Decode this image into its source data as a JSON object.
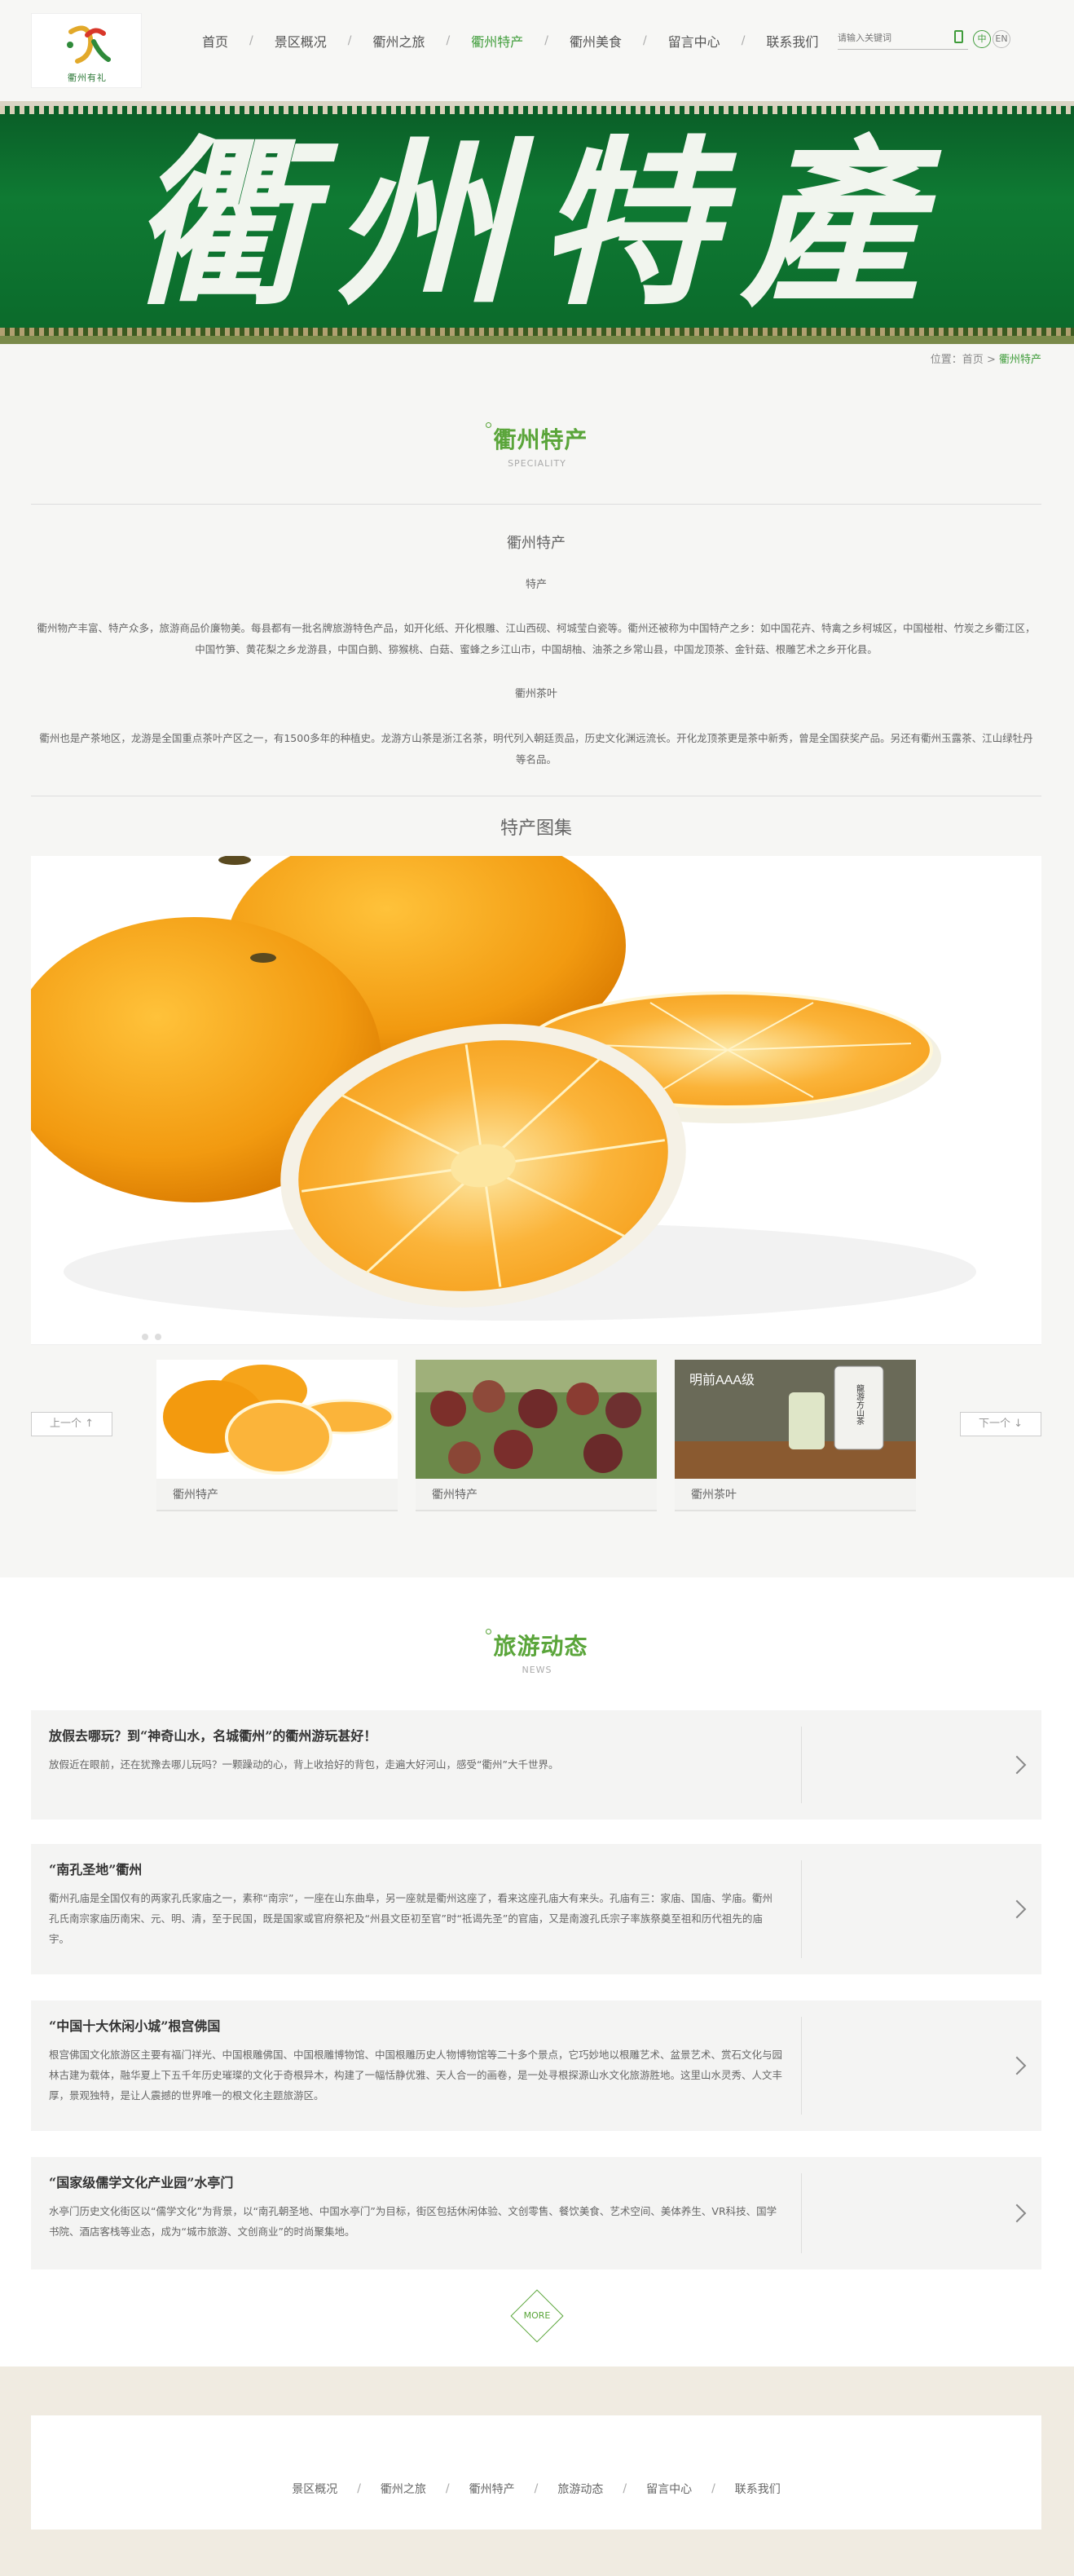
{
  "header": {
    "logo_text": "衢州有礼",
    "nav": [
      "首页",
      "景区概况",
      "衢州之旅",
      "衢州特产",
      "衢州美食",
      "留言中心",
      "联系我们"
    ],
    "active_index": 3,
    "search_placeholder": "请输入关键词",
    "lang_cn": "中",
    "lang_en": "EN"
  },
  "banner": {
    "title": "衢州特產"
  },
  "breadcrumb": {
    "prefix": "位置：",
    "home": "首页",
    "sep": ">",
    "current": "衢州特产"
  },
  "section1": {
    "title": "衢州特产",
    "subtitle": "SPECIALITY",
    "article_title": "衢州特产",
    "sub1": "特产",
    "para1": "衢州物产丰富、特产众多，旅游商品价廉物美。每县都有一批名牌旅游特色产品，如开化纸、开化根雕、江山西砚、柯城莹白瓷等。衢州还被称为中国特产之乡：如中国花卉、特禽之乡柯城区，中国椪柑、竹炭之乡衢江区，中国竹笋、黄花梨之乡龙游县，中国白鹅、猕猴桃、白菇、蜜蜂之乡江山市，中国胡柚、油茶之乡常山县，中国龙顶茶、金针菇、根雕艺术之乡开化县。",
    "sub2": "衢州茶叶",
    "para2": "衢州也是产茶地区，龙游是全国重点茶叶产区之一，有1500多年的种植史。龙游方山茶是浙江名茶，明代列入朝廷贡品，历史文化渊远流长。开化龙顶茶更是茶中新秀，曾是全国获奖产品。另还有衢州玉露茶、江山绿牡丹等名品。"
  },
  "gallery": {
    "title": "特产图集",
    "prev": "上一个 ↑",
    "next": "下一个 ↓",
    "thumbs": [
      {
        "caption": "衢州特产"
      },
      {
        "caption": "衢州特产"
      },
      {
        "caption": "衢州茶叶",
        "pack_text": "明前AAA级",
        "tea_name": "龍游方山茶"
      }
    ]
  },
  "news": {
    "title": "旅游动态",
    "subtitle": "NEWS",
    "items": [
      {
        "title": "放假去哪玩？到“神奇山水，名城衢州”的衢州游玩甚好！",
        "desc": "放假近在眼前，还在犹豫去哪儿玩吗？一颗躁动的心，背上收拾好的背包，走遍大好河山，感受“衢州”大千世界。"
      },
      {
        "title": "“南孔圣地”衢州",
        "desc": "衢州孔庙是全国仅有的两家孔氏家庙之一，素称“南宗”，一座在山东曲阜，另一座就是衢州这座了，看来这座孔庙大有来头。孔庙有三：家庙、国庙、学庙。衢州孔氏南宗家庙历南宋、元、明、清，至于民国，既是国家或官府祭祀及“州县文臣初至官”时“祗谒先圣”的官庙，又是南渡孔氏宗子率族祭奠至祖和历代祖先的庙宇。"
      },
      {
        "title": "“中国十大休闲小城”根宫佛国",
        "desc": "根宫佛国文化旅游区主要有福门祥光、中国根雕佛国、中国根雕博物馆、中国根雕历史人物博物馆等二十多个景点，它巧妙地以根雕艺术、盆景艺术、赏石文化与园林古建为载体，融华夏上下五千年历史璀璨的文化于奇根异木，构建了一幅恬静优雅、天人合一的画卷，是一处寻根探源山水文化旅游胜地。这里山水灵秀、人文丰厚，景观独特，是让人震撼的世界唯一的根文化主题旅游区。"
      },
      {
        "title": "“国家级儒学文化产业园”水亭门",
        "desc": "水亭门历史文化街区以“儒学文化”为背景，以“南孔朝圣地、中国水亭门”为目标，街区包括休闲体验、文创零售、餐饮美食、艺术空间、美体养生、VR科技、国学书院、酒店客栈等业态，成为“城市旅游、文创商业”的时尚聚集地。"
      }
    ],
    "more": "MORE"
  },
  "footer": {
    "nav": [
      "景区概况",
      "衢州之旅",
      "衢州特产",
      "旅游动态",
      "留言中心",
      "联系我们"
    ]
  }
}
